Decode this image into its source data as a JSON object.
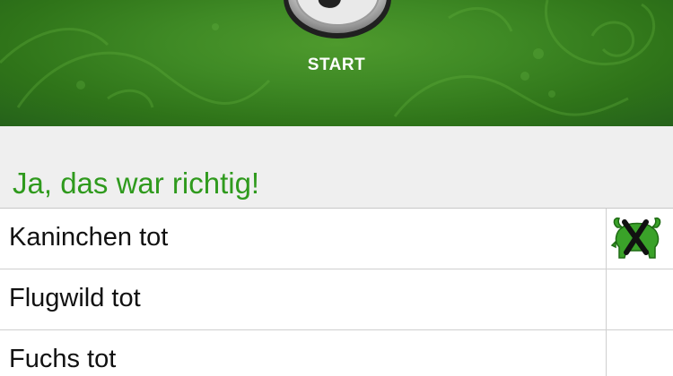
{
  "header": {
    "start_label": "START"
  },
  "feedback": {
    "text": "Ja, das war richtig!",
    "color": "#2f9a1d"
  },
  "table": {
    "rows": [
      {
        "label": "Kaninchen tot",
        "marked": true,
        "mark_icon": "wild-boar-crossed-icon"
      },
      {
        "label": "Flugwild tot",
        "marked": false
      },
      {
        "label": "Fuchs tot",
        "marked": false
      }
    ]
  },
  "colors": {
    "header_green": "#3f8a25",
    "background_gray": "#efefef",
    "divider": "#cfcfcf"
  }
}
